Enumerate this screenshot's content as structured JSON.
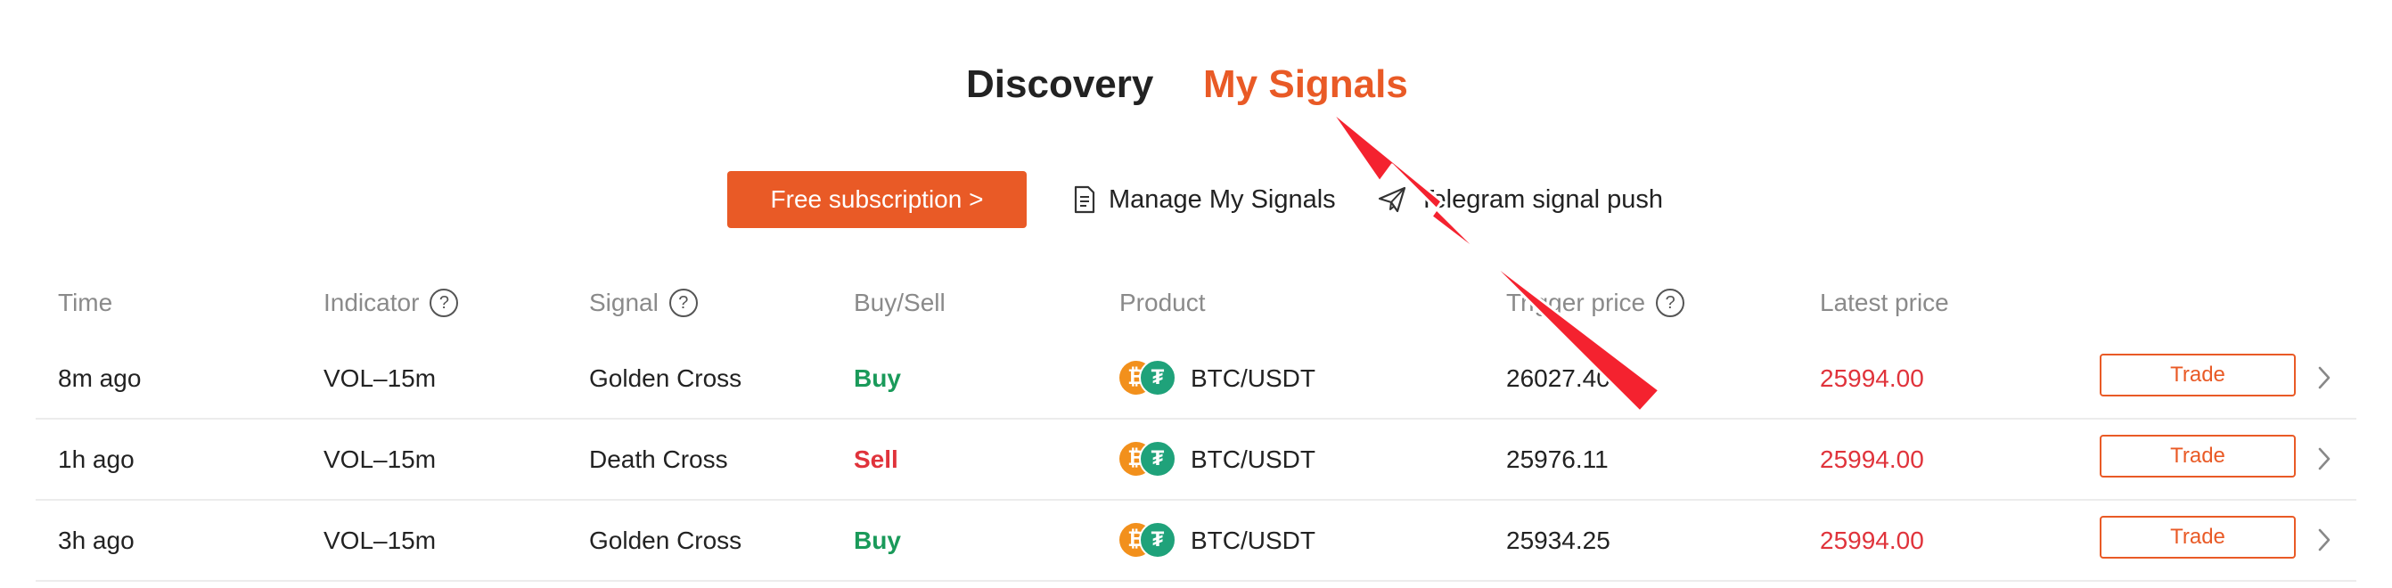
{
  "tabs": {
    "discovery": "Discovery",
    "my_signals": "My Signals"
  },
  "actions": {
    "subscribe": "Free subscription >",
    "manage": "Manage My Signals",
    "telegram": "Telegram signal push"
  },
  "columns": {
    "time": "Time",
    "indicator": "Indicator",
    "signal": "Signal",
    "buy_sell": "Buy/Sell",
    "product": "Product",
    "trigger_price": "Trigger price",
    "latest_price": "Latest price"
  },
  "help_glyph": "?",
  "coins": {
    "btc_glyph": "₿",
    "usdt_glyph": "₮"
  },
  "rows": [
    {
      "time": "8m ago",
      "indicator": "VOL–15m",
      "signal": "Golden Cross",
      "side": "Buy",
      "product": "BTC/USDT",
      "trigger": "26027.40",
      "latest": "25994.00",
      "trade": "Trade"
    },
    {
      "time": "1h ago",
      "indicator": "VOL–15m",
      "signal": "Death Cross",
      "side": "Sell",
      "product": "BTC/USDT",
      "trigger": "25976.11",
      "latest": "25994.00",
      "trade": "Trade"
    },
    {
      "time": "3h ago",
      "indicator": "VOL–15m",
      "signal": "Golden Cross",
      "side": "Buy",
      "product": "BTC/USDT",
      "trigger": "25934.25",
      "latest": "25994.00",
      "trade": "Trade"
    }
  ],
  "colors": {
    "accent": "#e95a26",
    "buy": "#1a9a5a",
    "sell": "#e0333b",
    "annotation": "#f4222f"
  },
  "icons": {
    "manage": "document-icon",
    "telegram": "paper-plane-icon",
    "row_action": "chevron-right-icon",
    "annotation": "arrow-annotation"
  }
}
